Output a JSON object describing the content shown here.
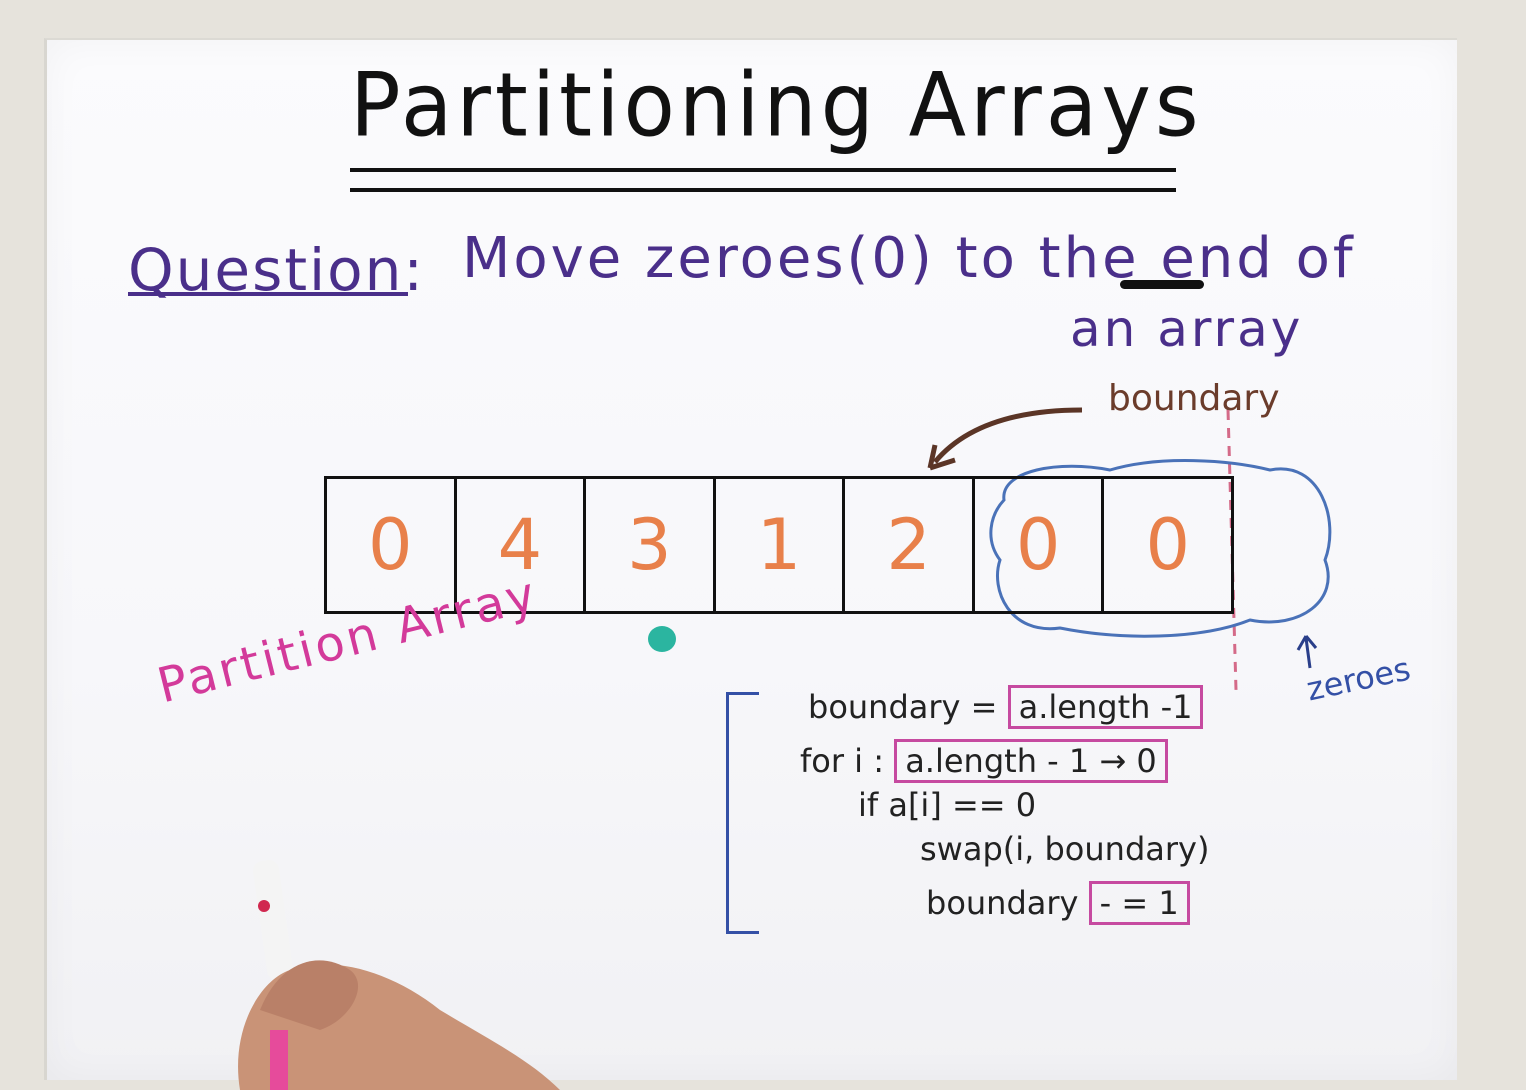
{
  "title": "Partitioning Arrays",
  "question": {
    "label": "Question:",
    "line1": "Move zeroes(0) to the end of",
    "line2": "an array"
  },
  "annotations": {
    "boundary": "boundary",
    "zeroes": "zeroes",
    "partition_array": "Partition Array"
  },
  "array": [
    "0",
    "4",
    "3",
    "1",
    "2",
    "0",
    "0"
  ],
  "code": {
    "line1_pre": "boundary = ",
    "line1_box": "a.length -1",
    "line2_pre": "for i : ",
    "line2_box": "a.length - 1 → 0",
    "line3": "if a[i] == 0",
    "line4": "swap(i, boundary)",
    "line5_pre": "boundary ",
    "line5_box": "- = 1"
  },
  "colors": {
    "title": "#111111",
    "question": "#4a2f8a",
    "array_digits": "#e8804a",
    "code_box": "#c64aa0",
    "partition": "#d33a9a",
    "zeroes": "#3450a6",
    "boundary": "#6b3c2b"
  }
}
